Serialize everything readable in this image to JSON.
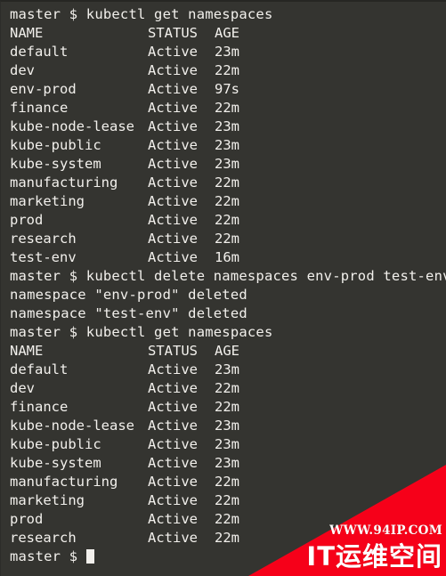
{
  "terminal": {
    "prompt": "master $ ",
    "background_color": "#343430",
    "text_color": "#f2f0ec",
    "lines": [
      {
        "kind": "command",
        "text": "master $ kubectl get namespaces"
      },
      {
        "kind": "header",
        "name": "NAME",
        "status": "STATUS",
        "age": "AGE"
      },
      {
        "kind": "row",
        "name": "default",
        "status": "Active",
        "age": "23m"
      },
      {
        "kind": "row",
        "name": "dev",
        "status": "Active",
        "age": "22m"
      },
      {
        "kind": "row",
        "name": "env-prod",
        "status": "Active",
        "age": "97s"
      },
      {
        "kind": "row",
        "name": "finance",
        "status": "Active",
        "age": "22m"
      },
      {
        "kind": "row",
        "name": "kube-node-lease",
        "status": "Active",
        "age": "23m"
      },
      {
        "kind": "row",
        "name": "kube-public",
        "status": "Active",
        "age": "23m"
      },
      {
        "kind": "row",
        "name": "kube-system",
        "status": "Active",
        "age": "23m"
      },
      {
        "kind": "row",
        "name": "manufacturing",
        "status": "Active",
        "age": "22m"
      },
      {
        "kind": "row",
        "name": "marketing",
        "status": "Active",
        "age": "22m"
      },
      {
        "kind": "row",
        "name": "prod",
        "status": "Active",
        "age": "22m"
      },
      {
        "kind": "row",
        "name": "research",
        "status": "Active",
        "age": "22m"
      },
      {
        "kind": "row",
        "name": "test-env",
        "status": "Active",
        "age": "16m"
      },
      {
        "kind": "command",
        "text": "master $ kubectl delete namespaces env-prod test-env"
      },
      {
        "kind": "output",
        "text": "namespace \"env-prod\" deleted"
      },
      {
        "kind": "output",
        "text": "namespace \"test-env\" deleted"
      },
      {
        "kind": "command",
        "text": "master $ kubectl get namespaces"
      },
      {
        "kind": "header",
        "name": "NAME",
        "status": "STATUS",
        "age": "AGE"
      },
      {
        "kind": "row",
        "name": "default",
        "status": "Active",
        "age": "23m"
      },
      {
        "kind": "row",
        "name": "dev",
        "status": "Active",
        "age": "22m"
      },
      {
        "kind": "row",
        "name": "finance",
        "status": "Active",
        "age": "22m"
      },
      {
        "kind": "row",
        "name": "kube-node-lease",
        "status": "Active",
        "age": "23m"
      },
      {
        "kind": "row",
        "name": "kube-public",
        "status": "Active",
        "age": "23m"
      },
      {
        "kind": "row",
        "name": "kube-system",
        "status": "Active",
        "age": "23m"
      },
      {
        "kind": "row",
        "name": "manufacturing",
        "status": "Active",
        "age": "22m"
      },
      {
        "kind": "row",
        "name": "marketing",
        "status": "Active",
        "age": "22m"
      },
      {
        "kind": "row",
        "name": "prod",
        "status": "Active",
        "age": "22m"
      },
      {
        "kind": "row",
        "name": "research",
        "status": "Active",
        "age": "22m"
      },
      {
        "kind": "prompt_cursor",
        "text": "master $ "
      }
    ]
  },
  "watermark": {
    "url": "WWW.94IP.COM",
    "brand": "IT运维空间",
    "color": "#f60019",
    "text_color": "#ffffff"
  }
}
